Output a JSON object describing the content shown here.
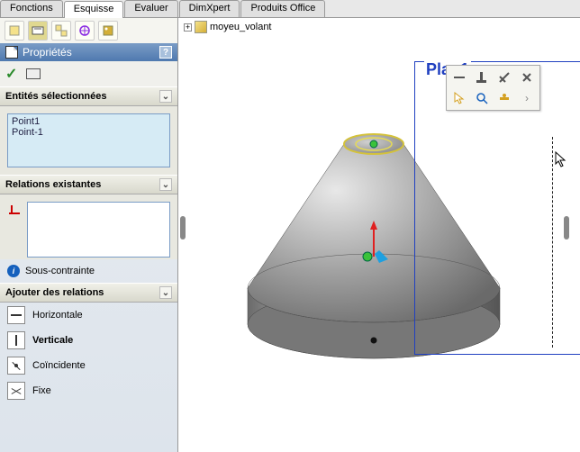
{
  "tabs": {
    "t0": "Fonctions",
    "t1": "Esquisse",
    "t2": "Evaluer",
    "t3": "DimXpert",
    "t4": "Produits Office"
  },
  "left": {
    "properties_title": "Propriétés",
    "help": "?",
    "sections": {
      "selected": {
        "title": "Entités sélectionnées",
        "items": [
          "Point1",
          "Point-1"
        ]
      },
      "existing": {
        "title": "Relations existantes",
        "status": "Sous-contrainte"
      },
      "add": {
        "title": "Ajouter des relations",
        "rels": {
          "h": "Horizontale",
          "v": "Verticale",
          "c": "Coïncidente",
          "f": "Fixe"
        }
      }
    }
  },
  "viewport": {
    "tree_item": "moyeu_volant",
    "plan_label": "Plan1"
  },
  "icons": {
    "expand": "+",
    "check": "✓",
    "info": "i",
    "chev": "⌄",
    "chevr": "›"
  }
}
